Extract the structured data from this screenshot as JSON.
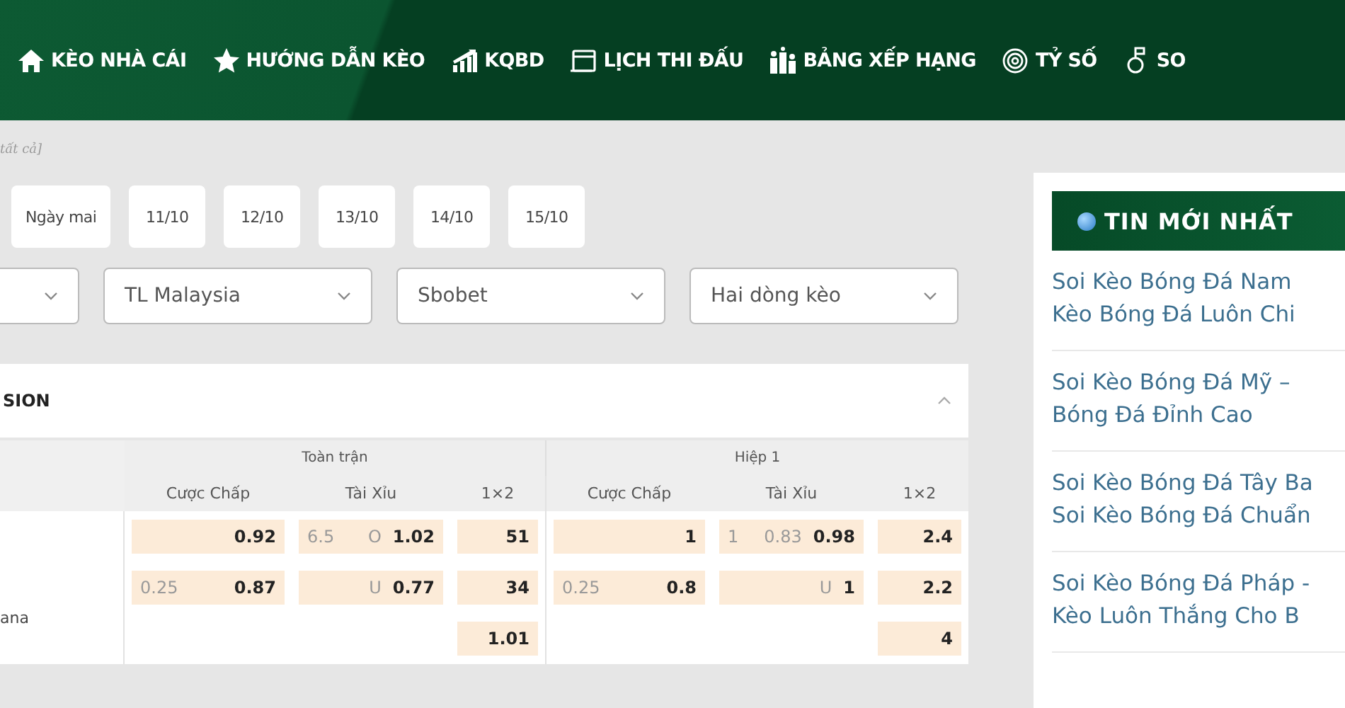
{
  "nav": [
    {
      "label": "KÈO NHÀ CÁI"
    },
    {
      "label": "HƯỚNG DẪN KÈO"
    },
    {
      "label": "KQBD"
    },
    {
      "label": "LỊCH THI ĐẤU"
    },
    {
      "label": "BẢNG XẾP HẠNG"
    },
    {
      "label": "TỶ SỐ"
    },
    {
      "label": "SO"
    }
  ],
  "breadcrumb": "tất cả]",
  "dates": [
    {
      "label": "Ngày mai",
      "selected": false
    },
    {
      "label": "11/10",
      "selected": false
    },
    {
      "label": "12/10",
      "selected": false
    },
    {
      "label": "13/10",
      "selected": false
    },
    {
      "label": "14/10",
      "selected": false
    },
    {
      "label": "15/10",
      "selected": false
    }
  ],
  "filters": [
    {
      "kind": "select"
    },
    {
      "kind": "select",
      "value": "TL Malaysia"
    },
    {
      "kind": "select",
      "value": "Sbobet"
    },
    {
      "kind": "select",
      "value": "Hai dòng kèo"
    }
  ],
  "league": {
    "name": "SION",
    "expanded": true
  },
  "groups": [
    "Toàn trận",
    "Hiệp 1"
  ],
  "columns": [
    "Cược Chấp",
    "Tài Xỉu",
    "1×2",
    "Cược Chấp",
    "Tài Xỉu",
    "1×2"
  ],
  "team": "ana",
  "rows": [
    {
      "full": {
        "hc_odds": "0.92",
        "tx_line": "6.5",
        "tx_side": "O",
        "tx_odds": "1.02",
        "x12": "51"
      },
      "half": {
        "hc_odds": "1",
        "tx_line": "1",
        "tx_side": "0.83",
        "tx_odds": "0.98",
        "x12": "2.4"
      }
    },
    {
      "full": {
        "hc_line": "0.25",
        "hc_odds": "0.87",
        "tx_side": "U",
        "tx_odds": "0.77",
        "x12": "34"
      },
      "half": {
        "hc_line": "0.25",
        "hc_odds": "0.8",
        "tx_side": "U",
        "tx_odds": "1",
        "x12": "2.2"
      }
    },
    {
      "full": {
        "x12": "1.01"
      },
      "half": {
        "x12": "4"
      }
    }
  ],
  "news": {
    "title": "TIN MỚI NHẤT",
    "items": [
      {
        "lines": [
          "Soi Kèo Bóng Đá Nam",
          "Kèo Bóng Đá Luôn Chi"
        ]
      },
      {
        "lines": [
          "Soi Kèo Bóng Đá Mỹ –",
          "Bóng Đá Đỉnh Cao"
        ]
      },
      {
        "lines": [
          "Soi Kèo Bóng Đá Tây Ba",
          "Soi Kèo Bóng Đá Chuẩn"
        ]
      },
      {
        "lines": [
          "Soi Kèo Bóng Đá Pháp -",
          "Kèo Luôn Thắng Cho B"
        ]
      }
    ]
  }
}
